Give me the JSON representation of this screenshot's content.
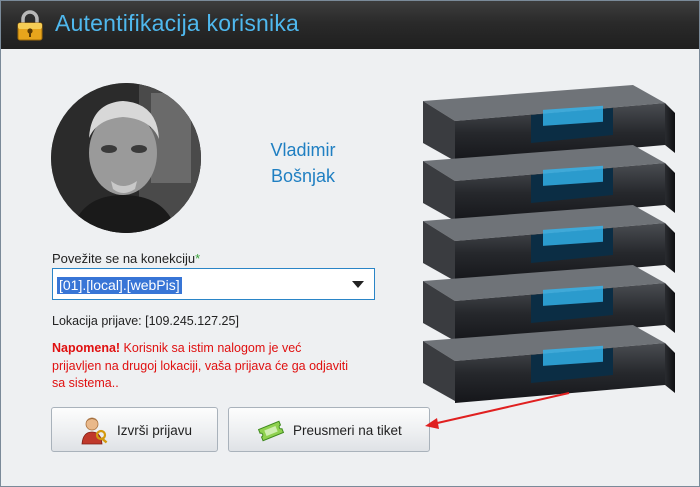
{
  "window": {
    "title": "Autentifikacija korisnika"
  },
  "user": {
    "name_line1": "Vladimir",
    "name_line2": "Bošnjak"
  },
  "connection": {
    "label": "Povežite se na konekciju",
    "required_mark": "*",
    "selected": "[01].[local].[webPis]"
  },
  "location": {
    "text": "Lokacija prijave: [109.245.127.25]"
  },
  "notice": {
    "label": "Napomena!",
    "text": " Korisnik sa istim nalogom je već prijavljen na drugoj lokaciji, vaša prijava će ga odjaviti sa sistema.."
  },
  "buttons": {
    "login": "Izvrši prijavu",
    "redirect": "Preusmeri na tiket"
  },
  "icons": {
    "title": "lock-icon",
    "login": "user-key-icon",
    "redirect": "ticket-icon"
  },
  "colors": {
    "title_text": "#4fb8ee",
    "username": "#1f7fc2",
    "notice": "#e01010",
    "selection": "#3875d6",
    "annotation_arrow": "#e02020"
  }
}
